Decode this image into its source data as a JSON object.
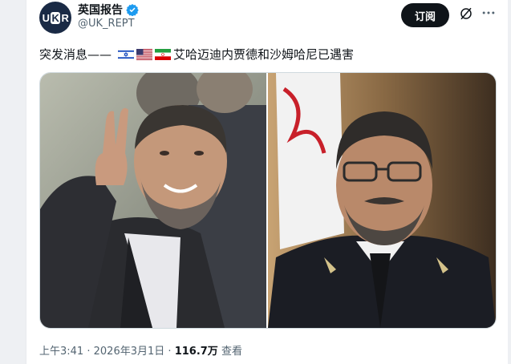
{
  "account": {
    "avatar_text_a": "U",
    "avatar_text_b": "K",
    "avatar_text_c": "R",
    "display_name": "英国报告",
    "handle": "@UK_REPT"
  },
  "actions": {
    "subscribe_label": "订阅"
  },
  "tweet": {
    "text": "突发消息—— 🇮🇱🇺🇸🇮🇷艾哈迈迪内贾德和沙姆哈尼已遇害",
    "text_prefix": "突发消息——",
    "text_body": "艾哈迈迪内贾德和沙姆哈尼已遇害",
    "flags": [
      "israel-flag",
      "usa-flag",
      "iran-flag"
    ]
  },
  "meta": {
    "time": "上午3:41",
    "separator": "·",
    "date": "2026年3月1日",
    "views": "116.7万",
    "views_label": "查看"
  },
  "icons": {
    "verified": "verified-badge-icon",
    "grok": "grok-icon",
    "more": "more-icon"
  },
  "colors": {
    "verified_blue": "#1d9bf0",
    "button_black": "#0f1419",
    "secondary_text": "#536471"
  }
}
